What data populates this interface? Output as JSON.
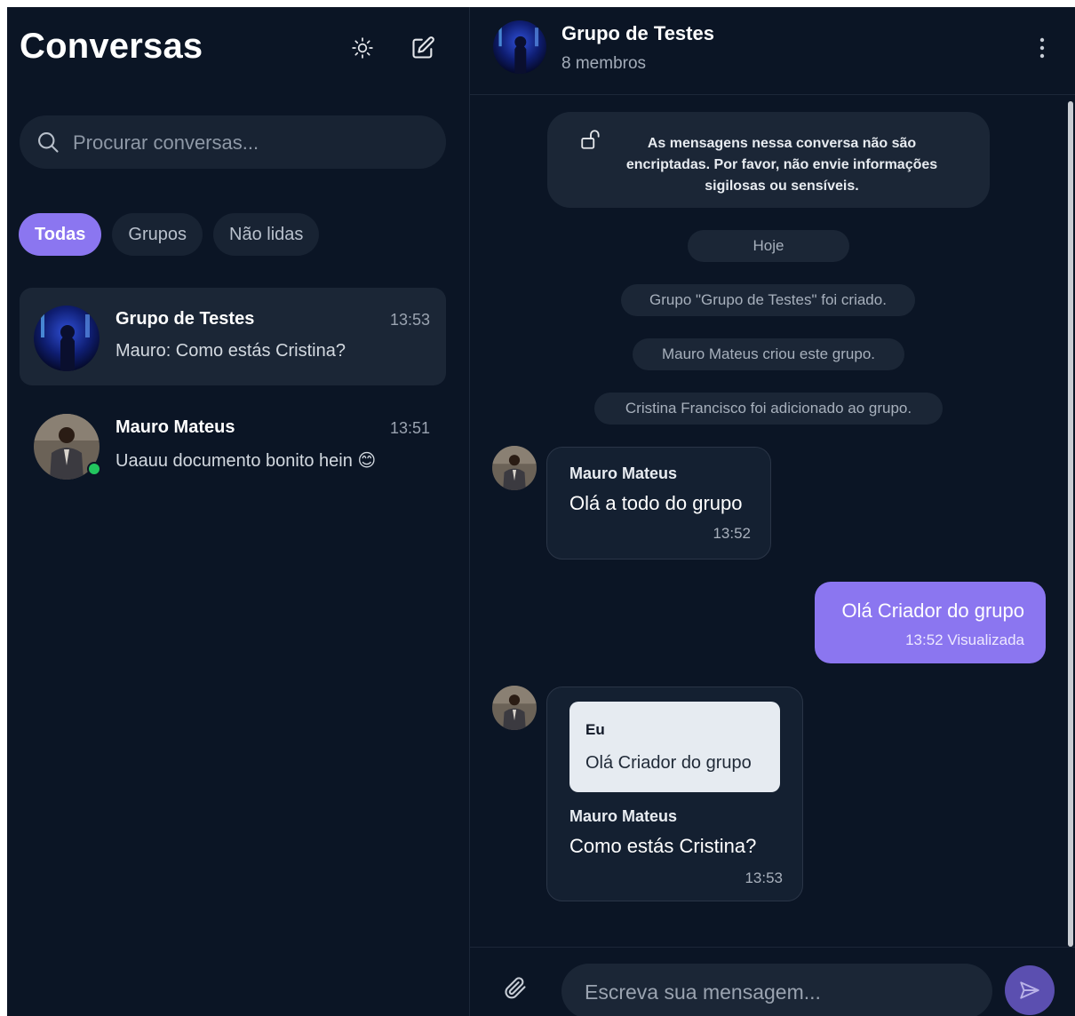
{
  "sidebar": {
    "title": "Conversas",
    "theme_icon": "sun-icon",
    "compose_icon": "edit-icon",
    "search": {
      "placeholder": "Procurar conversas..."
    },
    "filters": [
      "Todas",
      "Grupos",
      "Não lidas"
    ],
    "active_filter": "Todas",
    "conversations": [
      {
        "name": "Grupo de Testes",
        "time": "13:53",
        "preview": "Mauro: Como estás Cristina?",
        "active": true
      },
      {
        "name": "Mauro Mateus",
        "time": "13:51",
        "preview": "Uaauu documento bonito hein 😊",
        "online": true
      }
    ]
  },
  "chat": {
    "header": {
      "title": "Grupo de Testes",
      "subtitle": "8 membros",
      "menu_icon": "more-vertical-icon"
    },
    "notice": "As mensagens nessa conversa não são encriptadas. Por favor, não envie informações sigilosas ou sensíveis.",
    "day_separator": "Hoje",
    "system_messages": [
      "Grupo \"Grupo de Testes\" foi criado.",
      "Mauro Mateus criou este grupo.",
      "Cristina Francisco foi adicionado ao grupo."
    ],
    "messages": [
      {
        "direction": "in",
        "sender": "Mauro Mateus",
        "text": "Olá a todo do grupo",
        "time": "13:52"
      },
      {
        "direction": "out",
        "text": "Olá Criador do grupo",
        "time": "13:52",
        "status": "Visualizada"
      },
      {
        "direction": "in",
        "sender": "Mauro Mateus",
        "text": "Como estás Cristina?",
        "time": "13:53",
        "reply_to": {
          "sender": "Eu",
          "text": "Olá Criador do grupo"
        }
      }
    ],
    "composer": {
      "placeholder": "Escreva sua mensagem...",
      "attach_icon": "paperclip-icon",
      "send_icon": "send-icon"
    }
  },
  "colors": {
    "background": "#0b1525",
    "surface": "#1b2636",
    "accent": "#8b76f0",
    "online": "#22c55e"
  }
}
